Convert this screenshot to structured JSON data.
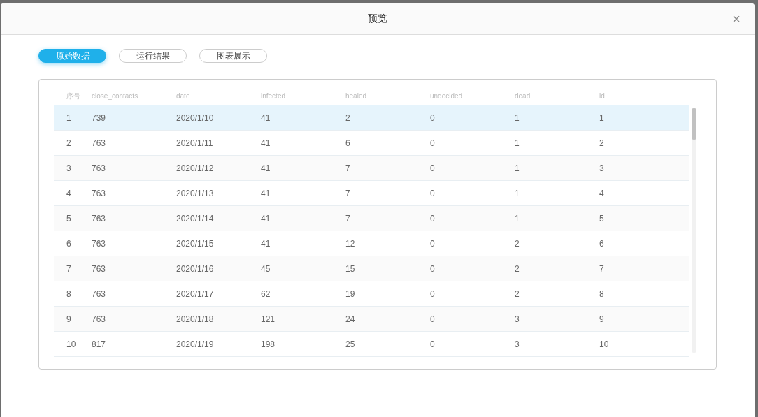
{
  "dialog": {
    "title": "预览",
    "close": "×"
  },
  "tabs": [
    {
      "label": "原始数据",
      "selected": true
    },
    {
      "label": "运行结果",
      "selected": false
    },
    {
      "label": "图表展示",
      "selected": false
    }
  ],
  "table": {
    "columns": [
      "序号",
      "close_contacts",
      "date",
      "infected",
      "healed",
      "undecided",
      "dead",
      "id"
    ],
    "rows": [
      {
        "cells": [
          "1",
          "739",
          "2020/1/10",
          "41",
          "2",
          "0",
          "1",
          "1"
        ],
        "selected": true
      },
      {
        "cells": [
          "2",
          "763",
          "2020/1/11",
          "41",
          "6",
          "0",
          "1",
          "2"
        ],
        "selected": false
      },
      {
        "cells": [
          "3",
          "763",
          "2020/1/12",
          "41",
          "7",
          "0",
          "1",
          "3"
        ],
        "selected": false
      },
      {
        "cells": [
          "4",
          "763",
          "2020/1/13",
          "41",
          "7",
          "0",
          "1",
          "4"
        ],
        "selected": false
      },
      {
        "cells": [
          "5",
          "763",
          "2020/1/14",
          "41",
          "7",
          "0",
          "1",
          "5"
        ],
        "selected": false
      },
      {
        "cells": [
          "6",
          "763",
          "2020/1/15",
          "41",
          "12",
          "0",
          "2",
          "6"
        ],
        "selected": false
      },
      {
        "cells": [
          "7",
          "763",
          "2020/1/16",
          "45",
          "15",
          "0",
          "2",
          "7"
        ],
        "selected": false
      },
      {
        "cells": [
          "8",
          "763",
          "2020/1/17",
          "62",
          "19",
          "0",
          "2",
          "8"
        ],
        "selected": false
      },
      {
        "cells": [
          "9",
          "763",
          "2020/1/18",
          "121",
          "24",
          "0",
          "3",
          "9"
        ],
        "selected": false
      },
      {
        "cells": [
          "10",
          "817",
          "2020/1/19",
          "198",
          "25",
          "0",
          "3",
          "10"
        ],
        "selected": false
      }
    ]
  }
}
